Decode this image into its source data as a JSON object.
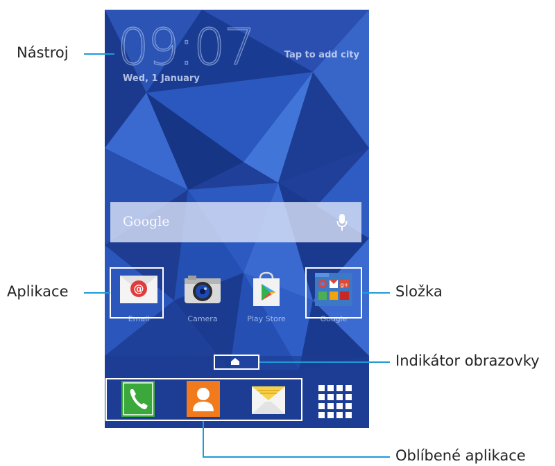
{
  "widget": {
    "clock": "09:07",
    "date": "Wed, 1 January",
    "add_city": "Tap to add city"
  },
  "search_bar": {
    "logo": "Google",
    "mic_icon": "microphone-icon"
  },
  "apps": [
    {
      "label": "Email",
      "icon": "email-icon"
    },
    {
      "label": "Camera",
      "icon": "camera-icon"
    },
    {
      "label": "Play Store",
      "icon": "play-store-icon"
    },
    {
      "label": "Google",
      "icon": "google-folder-icon"
    }
  ],
  "page_indicator": {
    "icon": "home-indicator-icon"
  },
  "dock": [
    {
      "icon": "phone-icon",
      "color": "#3aa83a"
    },
    {
      "icon": "contacts-icon",
      "color": "#f07a1c"
    },
    {
      "icon": "messages-icon",
      "color": "#f5d24a"
    },
    {
      "icon": "apps-grid-icon",
      "color": "#ffffff"
    }
  ],
  "callouts": {
    "widget": "Nástroj",
    "app": "Aplikace",
    "folder": "Složka",
    "screen_indicator": "Indikátor obrazovky",
    "favorites": "Oblíbené aplikace"
  },
  "colors": {
    "accent_line": "#1e9ad6",
    "wallpaper": "#1e3f9a",
    "highlight_box": "#ffffff"
  }
}
